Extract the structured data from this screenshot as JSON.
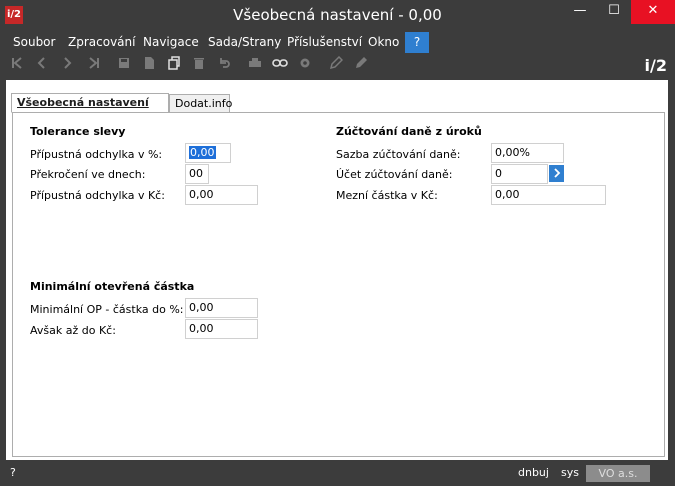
{
  "window": {
    "logo": "i/2",
    "title": "Všeobecná nastavení - 0,00",
    "min_glyph": "—",
    "max_glyph": "☐",
    "close_glyph": "✕"
  },
  "menu": {
    "items": [
      "Soubor",
      "Zpracování",
      "Navigace",
      "Sada/Strany",
      "Příslušenství",
      "Okno"
    ],
    "help": "?"
  },
  "toolbar": {
    "brand": "i/2",
    "icons": [
      "first-record-icon",
      "previous-record-icon",
      "next-record-icon",
      "last-record-icon",
      "save-icon",
      "new-document-icon",
      "copy-icon",
      "delete-icon",
      "undo-icon",
      "print-icon",
      "link-icon",
      "settings-icon",
      "edit-icon",
      "pencil-icon"
    ]
  },
  "tabs": {
    "active": "Všeobecná nastavení",
    "inactive": "Dodat.info"
  },
  "tolerance": {
    "title": "Tolerance slevy",
    "odchylka_pct_label": "Přípustná odchylka v %:",
    "odchylka_pct_value": "0,00",
    "prekroceni_label": "Překročení ve dnech:",
    "prekroceni_value": "00",
    "odchylka_kc_label": "Přípustná odchylka v Kč:",
    "odchylka_kc_value": "0,00"
  },
  "zuctovani": {
    "title": "Zúčtování daně z úroků",
    "sazba_label": "Sazba zúčtování daně:",
    "sazba_value": "0,00%",
    "ucet_label": "Účet zúčtování daně:",
    "ucet_value": "0",
    "mezni_label": "Mezní částka v Kč:",
    "mezni_value": "0,00"
  },
  "minimal": {
    "title": "Minimální otevřená částka",
    "op_label": "Minimální OP - částka do %:",
    "op_value": "0,00",
    "avsak_label": "Avšak až do Kč:",
    "avsak_value": "0,00"
  },
  "status": {
    "help": "?",
    "user": "dnbuj",
    "db": "sys",
    "company": "VO a.s."
  }
}
